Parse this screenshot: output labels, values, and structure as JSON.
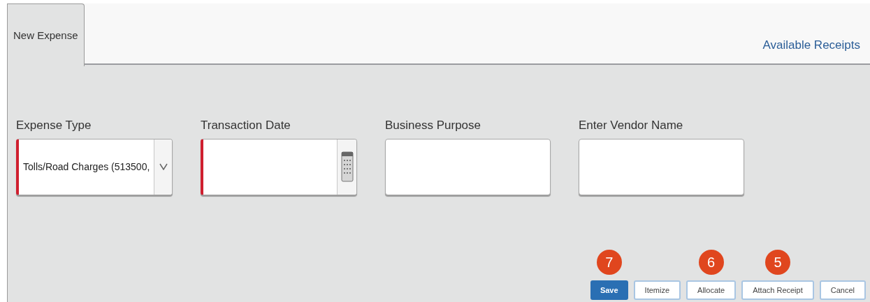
{
  "tabs": [
    {
      "label": "New Expense",
      "selected": true
    }
  ],
  "header_link": "Available Receipts",
  "fields": [
    {
      "label": "Expense Type",
      "kind": "select",
      "value": "Tolls/Road Charges (513500,",
      "required": true
    },
    {
      "label": "Transaction Date",
      "kind": "date",
      "required": true
    },
    {
      "label": "Business Purpose",
      "kind": "text",
      "required": false
    },
    {
      "label": "Enter Vendor Name",
      "kind": "text",
      "required": false
    }
  ],
  "buttons": [
    {
      "label": "Save",
      "kind": "primary",
      "callout": "7"
    },
    {
      "label": "Itemize",
      "kind": "secondary"
    },
    {
      "label": "Allocate",
      "kind": "secondary",
      "callout": "6"
    },
    {
      "label": "Attach Receipt",
      "kind": "secondary",
      "callout": "5"
    },
    {
      "label": "Cancel",
      "kind": "secondary"
    }
  ]
}
